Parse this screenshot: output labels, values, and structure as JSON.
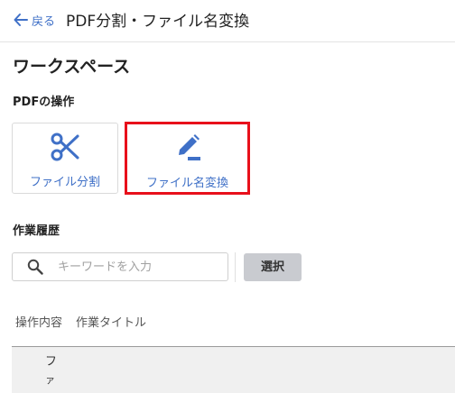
{
  "header": {
    "back_label": "戻る",
    "title": "PDF分割・ファイル名変換"
  },
  "workspace": {
    "title": "ワークスペース"
  },
  "pdf_operations": {
    "label": "PDFの操作",
    "cards": [
      {
        "label": "ファイル分割",
        "icon": "scissors-icon"
      },
      {
        "label": "ファイル名変換",
        "icon": "pencil-edit-icon",
        "highlighted": true
      }
    ]
  },
  "history": {
    "label": "作業履歴",
    "search": {
      "placeholder": "キーワードを入力",
      "value": ""
    },
    "select_label": "選択",
    "columns": [
      "操作内容",
      "作業タイトル"
    ],
    "rows": [
      {
        "text": "フ"
      },
      {
        "text": "ァ"
      }
    ]
  },
  "colors": {
    "accent": "#3f70c7",
    "highlight_border": "#e8101b",
    "select_button_bg": "#c9cbd0"
  }
}
